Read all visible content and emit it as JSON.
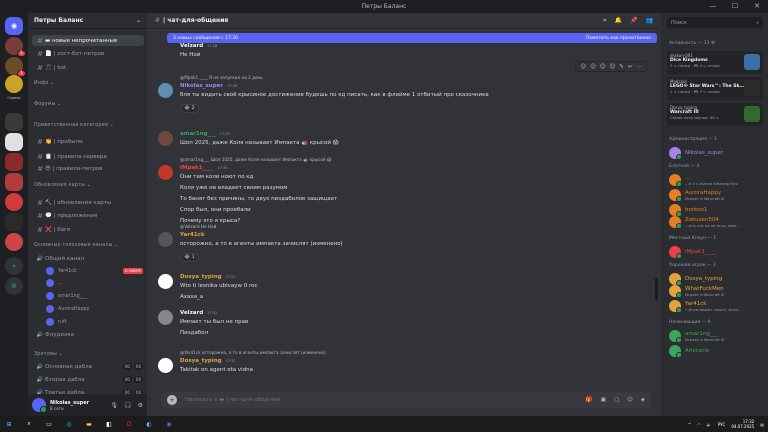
{
  "titlebar": {
    "title": "Петры Баланс",
    "minimize": "—",
    "maximize": "☐",
    "close": "✕"
  },
  "servers": [
    {
      "label": "",
      "icon": "discord-logo",
      "badge": ""
    },
    {
      "label": "",
      "icon": "",
      "badge": "1"
    },
    {
      "label": "",
      "icon": "",
      "badge": "1"
    },
    {
      "label": "Сервер",
      "icon": "",
      "badge": ""
    }
  ],
  "sidebar": {
    "server_name": "Петры Баланс",
    "rows": [
      {
        "type": "chan",
        "icon": "#",
        "label": "▬ новые непрочитанные",
        "active": true
      },
      {
        "type": "chan",
        "icon": "#",
        "label": "📄 | хост-бот-петров"
      },
      {
        "type": "chan",
        "icon": "#",
        "label": "🎵 | bot"
      },
      {
        "type": "cat",
        "label": "Инфо ⌄"
      },
      {
        "type": "cat",
        "label": "Форумы ⌄"
      },
      {
        "type": "cat",
        "label": "Приветственная категория ⌄"
      },
      {
        "type": "chan",
        "icon": "#",
        "label": "👏 | прибыли"
      },
      {
        "type": "chan",
        "icon": "#",
        "label": "📋 | правила-сервера"
      },
      {
        "type": "chan",
        "icon": "#",
        "label": "😎 | правила-петров"
      },
      {
        "type": "cat",
        "label": "Обновления карты ⌄"
      },
      {
        "type": "chan",
        "icon": "#",
        "label": "🔨 | обновления-карты"
      },
      {
        "type": "chan",
        "icon": "#",
        "label": "💬 | предложения"
      },
      {
        "type": "chan",
        "icon": "#",
        "label": "❌ | баги"
      },
      {
        "type": "cat",
        "label": "Основные голосовые каналы ⌄"
      },
      {
        "type": "voice",
        "icon": "🔊",
        "label": "Общий канал"
      },
      {
        "type": "user",
        "label": "Yar41ck",
        "live": "В ЭФИРЕ"
      },
      {
        "type": "user",
        "label": "..."
      },
      {
        "type": "user",
        "label": "amar1ng___"
      },
      {
        "type": "user",
        "label": "AuroraHappy"
      },
      {
        "type": "user",
        "label": "ruft"
      },
      {
        "type": "voice",
        "icon": "🔊",
        "label": "Флудилка"
      },
      {
        "type": "cat",
        "label": "Зритовы ⌄"
      },
      {
        "type": "voice",
        "icon": "🔊",
        "label": "Основная дабла",
        "c1": "00",
        "c2": "00"
      },
      {
        "type": "voice",
        "icon": "🔊",
        "label": "Вторая дабла",
        "c1": "00",
        "c2": "00"
      },
      {
        "type": "voice",
        "icon": "🔊",
        "label": "Третья дабла",
        "c1": "00",
        "c2": "00"
      }
    ],
    "user": {
      "name": "Nikolas_super",
      "status": "В сети"
    }
  },
  "main": {
    "channel": "| чат-для-общения",
    "newbar": {
      "text": "3 новых сообщения с 17:30",
      "mark": "Пометить как прочитанное"
    },
    "composer_placeholder": "Написать в ▬ | чат-для-общения",
    "messages": [
      {
        "name": "Velzard",
        "time": "17:26",
        "color": "#f2f3f5",
        "lines": [
          "Не Ной"
        ]
      },
      {
        "name": "Nikolas_super",
        "time": "17:26",
        "color": "#a682e8",
        "reply": "@Mpak1 ____ Я не запускал на 2 день",
        "lines": [
          "бля ты видать своё крысиное достижение будешь по кд писать, как в флейме 1 отбитый про сказочника"
        ],
        "react": "2"
      },
      {
        "name": "amar1ng___",
        "time": "17:30",
        "color": "#3ba55c",
        "lines": [
          "Шоп 2025, даже Коля называет Импакта 🦔 крысой 😱"
        ]
      },
      {
        "name": "iMpak1____",
        "time": "17:30",
        "color": "#f23f43",
        "reply": "@amar1ng___ Шоп 2025, даже Коля называет Импакта 🦔 крысой 😱",
        "lines": [
          "Они там коле ноют по кд",
          "Коля уже не владеет своим разумом",
          "То банят без причины, то двух пиздаболов защищает",
          "Спор был, они проебали",
          "Почему это я крыса?"
        ]
      },
      {
        "name": "Yar41ck",
        "time": "",
        "color": "#e6a23c",
        "reply": "@Velzard Не Ной",
        "lines": [
          "осторожно, а то в агенты импакта зачислят (изменено)"
        ],
        "react": "1"
      },
      {
        "name": "Dosya_typing",
        "time": "17:27",
        "color": "#e6a23c",
        "lines": [
          "Wto ti lesnika ubivayw 0 roc",
          "Ахаха_а"
        ]
      },
      {
        "name": "Velzard",
        "time": "17:32",
        "color": "#f2f3f5",
        "lines": [
          "Импакт ты был не прав",
          "Пиздабол"
        ]
      },
      {
        "name": "Dosya_typing",
        "time": "17:32",
        "color": "#e6a23c",
        "reply": "@Yar41ck осторожно, а то в агенты импакта зачислят (изменено)",
        "lines": [
          "Takitak on agent eta vidna"
        ]
      }
    ]
  },
  "members": {
    "search": "Поиск",
    "activity_title": "Активность — 13 ⚙",
    "activities": [
      {
        "who": "drakon-001",
        "title": "Dice Kingdoms",
        "sub": "3 ч. назад · 🎮 4 ч. назад"
      },
      {
        "who": "Madcool",
        "title": "LEGO® Star Wars™: The Sk…",
        "sub": "1 ч. назад · 🎮 3 ч. назад"
      },
      {
        "who": "Dosya_typing",
        "title": "Warcraft III",
        "sub": "Самая популярная: 49 ч."
      }
    ],
    "groups": [
      {
        "title": "Администрация — 1",
        "users": [
          {
            "name": "Nikolas_super",
            "color": "#a682e8",
            "sub": ""
          }
        ]
      },
      {
        "title": "Блатной — 4",
        "users": [
          {
            "name": "…",
            "color": "#e67e22",
            "sub": "…е 0 с жизни Ювелир бля"
          },
          {
            "name": "AuroraHappy",
            "color": "#e67e22",
            "sub": "Играет в Warcraft III"
          },
          {
            "name": "borbos1",
            "color": "#e67e22",
            "sub": ""
          },
          {
            "name": "Zakusen504",
            "color": "#e67e22",
            "sub": "…ить это на не игру, ваш…"
          }
        ]
      },
      {
        "title": "Местный Клоун — 1",
        "users": [
          {
            "name": "iMpak1____",
            "color": "#f23f43",
            "sub": ""
          }
        ]
      },
      {
        "title": "Хороший игрок — 3",
        "users": [
          {
            "name": "Dosya_typing",
            "color": "#e6a23c",
            "sub": ""
          },
          {
            "name": "WhatFuckMen",
            "color": "#e6a23c",
            "sub": "Играет в Warcraft III"
          },
          {
            "name": "Yar41ck",
            "color": "#e6a23c",
            "sub": "• Игра может смысл, если…"
          }
        ]
      },
      {
        "title": "Начинающий — 9",
        "users": [
          {
            "name": "amar1ng___",
            "color": "#3ba55c",
            "sub": "Играет в Warcraft III"
          },
          {
            "name": "Amiracle",
            "color": "#3ba55c",
            "sub": ""
          }
        ]
      }
    ]
  },
  "taskbar": {
    "lang": "РУС",
    "time": "17:32",
    "date": "04.07.2025"
  },
  "colors": {
    "accent": "#5865f2",
    "online": "#23a55a",
    "danger": "#f23f43"
  }
}
